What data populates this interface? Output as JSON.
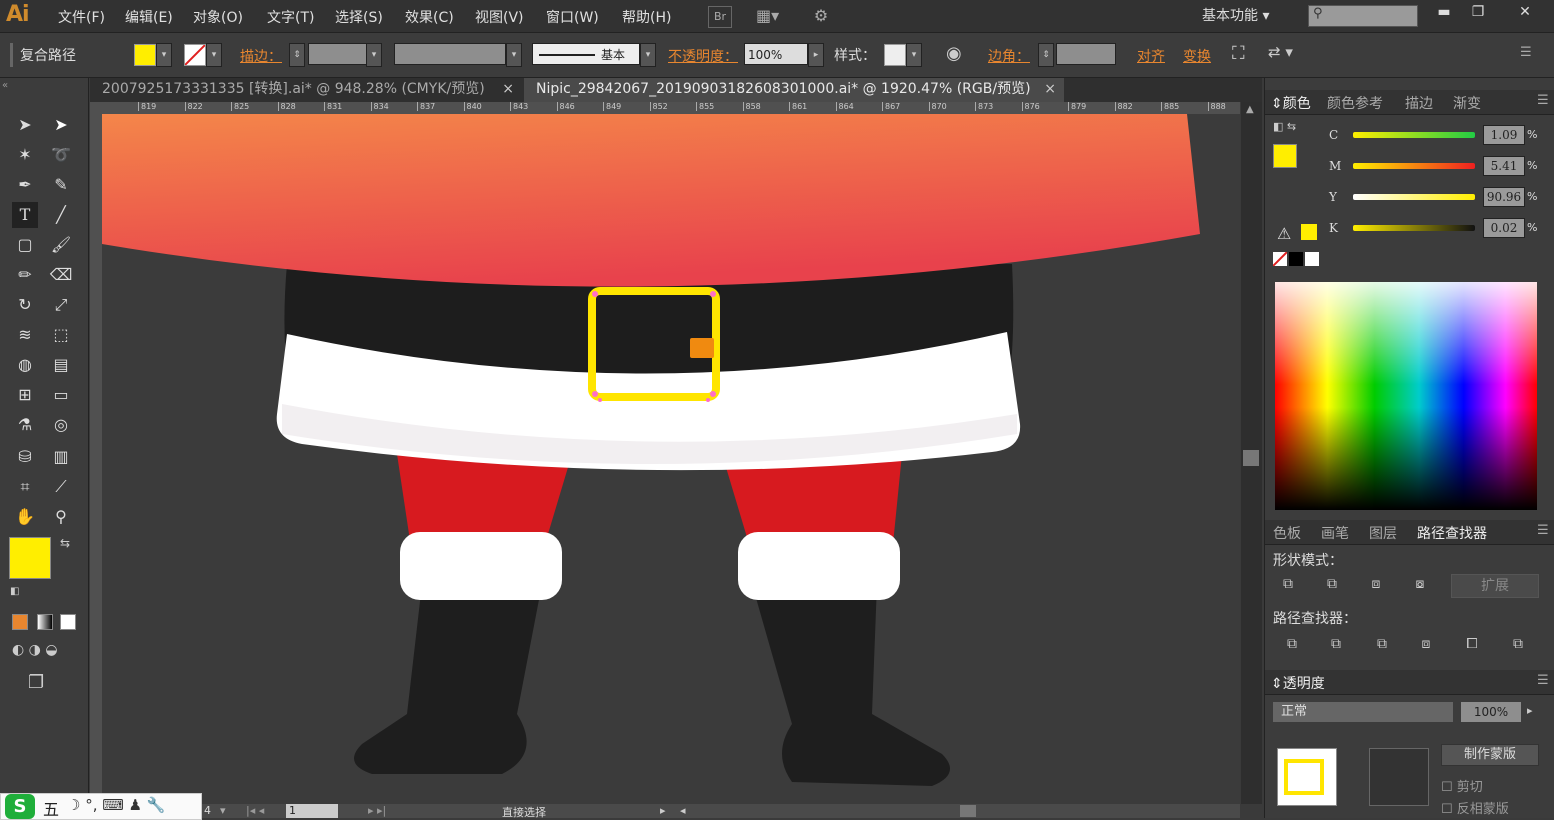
{
  "app": {
    "logo": "Ai",
    "menus": [
      "文件(F)",
      "编辑(E)",
      "对象(O)",
      "文字(T)",
      "选择(S)",
      "效果(C)",
      "视图(V)",
      "窗口(W)",
      "帮助(H)"
    ],
    "bridge_label": "Br",
    "workspace": "基本功能",
    "search_placeholder": ""
  },
  "control_bar": {
    "selection_type": "复合路径",
    "fill_color": "#ffee00",
    "stroke_label": "描边：",
    "brush_label": "基本",
    "opacity_label": "不透明度：",
    "opacity_value": "100%",
    "style_label": "样式：",
    "corner_label": "边角：",
    "align_label": "对齐",
    "transform_label": "变换"
  },
  "tabs": [
    {
      "label": "2007925173331335 [转换].ai* @ 948.28% (CMYK/预览)",
      "active": false
    },
    {
      "label": "Nipic_29842067_20190903182608301000.ai* @ 1920.47% (RGB/预览)",
      "active": true
    }
  ],
  "ruler_ticks": [
    "819",
    "822",
    "825",
    "828",
    "831",
    "834",
    "837",
    "840",
    "843",
    "846",
    "849",
    "852",
    "855",
    "858",
    "861",
    "864",
    "867",
    "870",
    "873",
    "876",
    "879",
    "882",
    "885",
    "888"
  ],
  "color_panel": {
    "tabs": [
      "颜色",
      "颜色参考",
      "描边",
      "渐变"
    ],
    "channels": [
      {
        "name": "C",
        "value": "1.09"
      },
      {
        "name": "M",
        "value": "5.41"
      },
      {
        "name": "Y",
        "value": "90.96"
      },
      {
        "name": "K",
        "value": "0.02"
      }
    ],
    "percent": "%",
    "current_color": "#ffee00"
  },
  "pathfinder_panel": {
    "tabs": [
      "色板",
      "画笔",
      "图层",
      "路径查找器"
    ],
    "shape_modes_label": "形状模式：",
    "expand_label": "扩展",
    "pathfinders_label": "路径查找器："
  },
  "transparency_panel": {
    "title": "透明度",
    "mode": "正常",
    "opacity": "100%",
    "make_mask": "制作蒙版",
    "clip": "剪切",
    "invert_mask": "反相蒙版"
  },
  "status_bar": {
    "zoom": "4",
    "page": "1",
    "tool": "直接选择"
  },
  "ime": {
    "label": "五"
  }
}
